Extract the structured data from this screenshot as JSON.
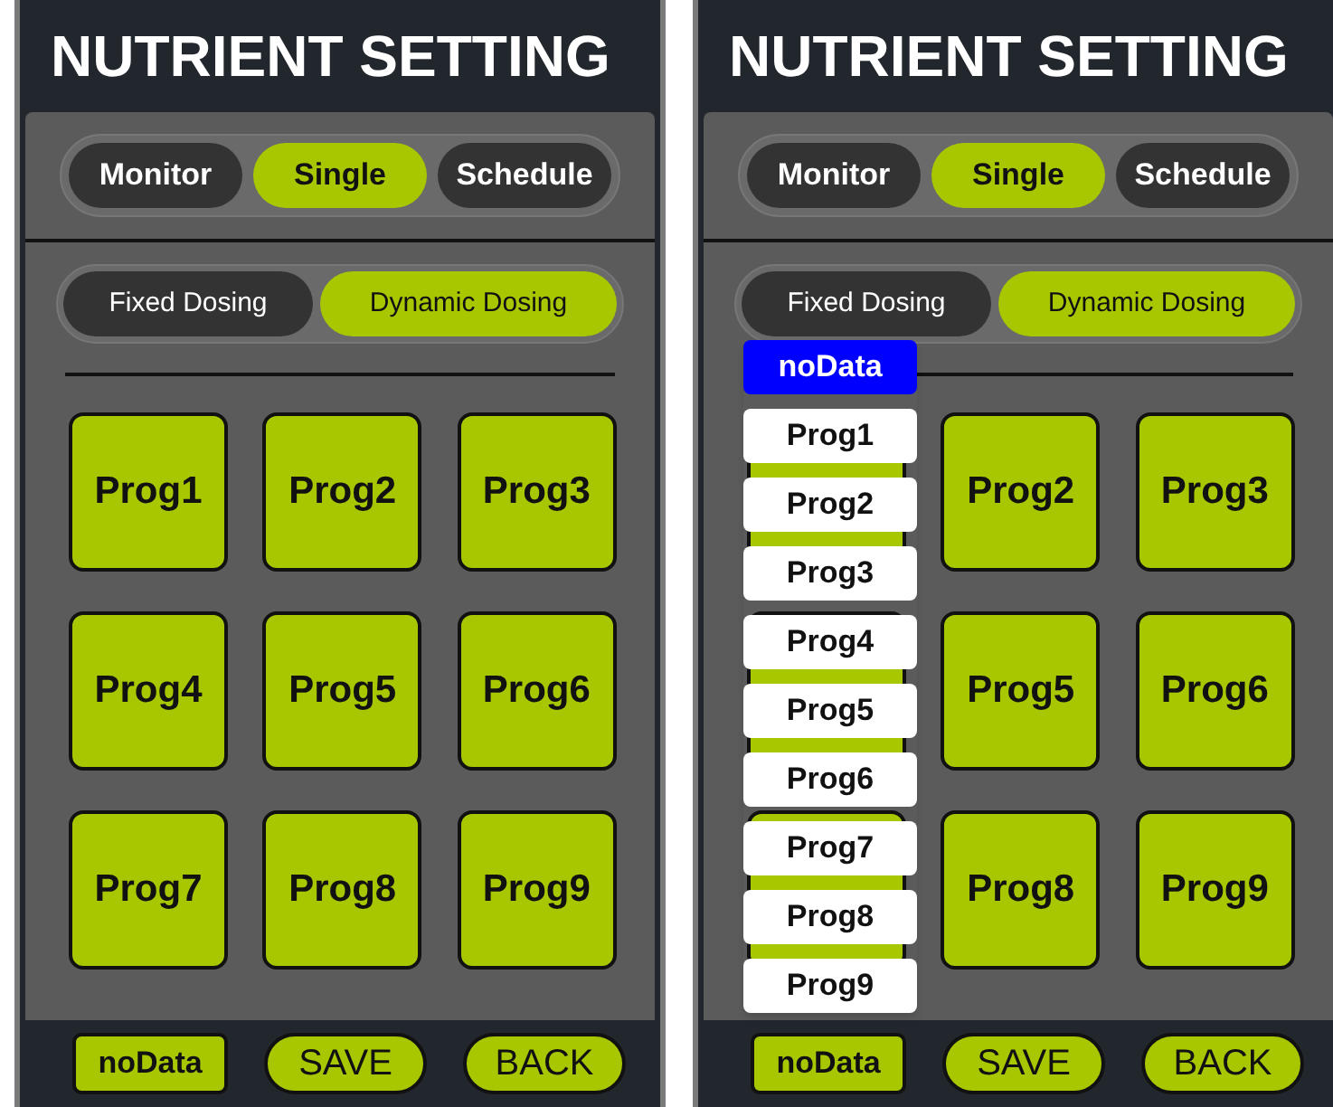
{
  "screens": [
    {
      "title": "NUTRIENT SETTING",
      "mode_tabs": [
        {
          "label": "Monitor",
          "selected": false
        },
        {
          "label": "Single",
          "selected": true
        },
        {
          "label": "Schedule",
          "selected": false
        }
      ],
      "dosing_tabs": [
        {
          "label": "Fixed Dosing",
          "selected": false
        },
        {
          "label": "Dynamic Dosing",
          "selected": true
        }
      ],
      "programs": [
        {
          "label": "Prog1"
        },
        {
          "label": "Prog2"
        },
        {
          "label": "Prog3"
        },
        {
          "label": "Prog4"
        },
        {
          "label": "Prog5"
        },
        {
          "label": "Prog6"
        },
        {
          "label": "Prog7"
        },
        {
          "label": "Prog8"
        },
        {
          "label": "Prog9"
        }
      ],
      "footer_buttons": [
        {
          "label": "noData",
          "kind": "value"
        },
        {
          "label": "SAVE",
          "kind": "action"
        },
        {
          "label": "BACK",
          "kind": "action"
        }
      ]
    },
    {
      "title": "NUTRIENT SETTING",
      "mode_tabs": [
        {
          "label": "Monitor",
          "selected": false
        },
        {
          "label": "Single",
          "selected": true
        },
        {
          "label": "Schedule",
          "selected": false
        }
      ],
      "dosing_tabs": [
        {
          "label": "Fixed Dosing",
          "selected": false
        },
        {
          "label": "Dynamic Dosing",
          "selected": true
        }
      ],
      "programs": [
        {
          "kind": "hidden"
        },
        {
          "label": "Prog2",
          "kind": "labelled"
        },
        {
          "label": "Prog3",
          "kind": "labelled"
        },
        {
          "kind": "hidden"
        },
        {
          "label": "Prog5",
          "kind": "labelled"
        },
        {
          "label": "Prog6",
          "kind": "labelled"
        },
        {
          "kind": "hidden"
        },
        {
          "label": "Prog8",
          "kind": "labelled"
        },
        {
          "label": "Prog9",
          "kind": "labelled"
        }
      ],
      "dropdown": {
        "value": "noData",
        "options": [
          "Prog1",
          "Prog2",
          "Prog3",
          "Prog4",
          "Prog5",
          "Prog6",
          "Prog7",
          "Prog8",
          "Prog9"
        ]
      },
      "footer_buttons": [
        {
          "label": "noData",
          "kind": "value"
        },
        {
          "label": "SAVE",
          "kind": "action"
        },
        {
          "label": "BACK",
          "kind": "action"
        }
      ]
    }
  ]
}
